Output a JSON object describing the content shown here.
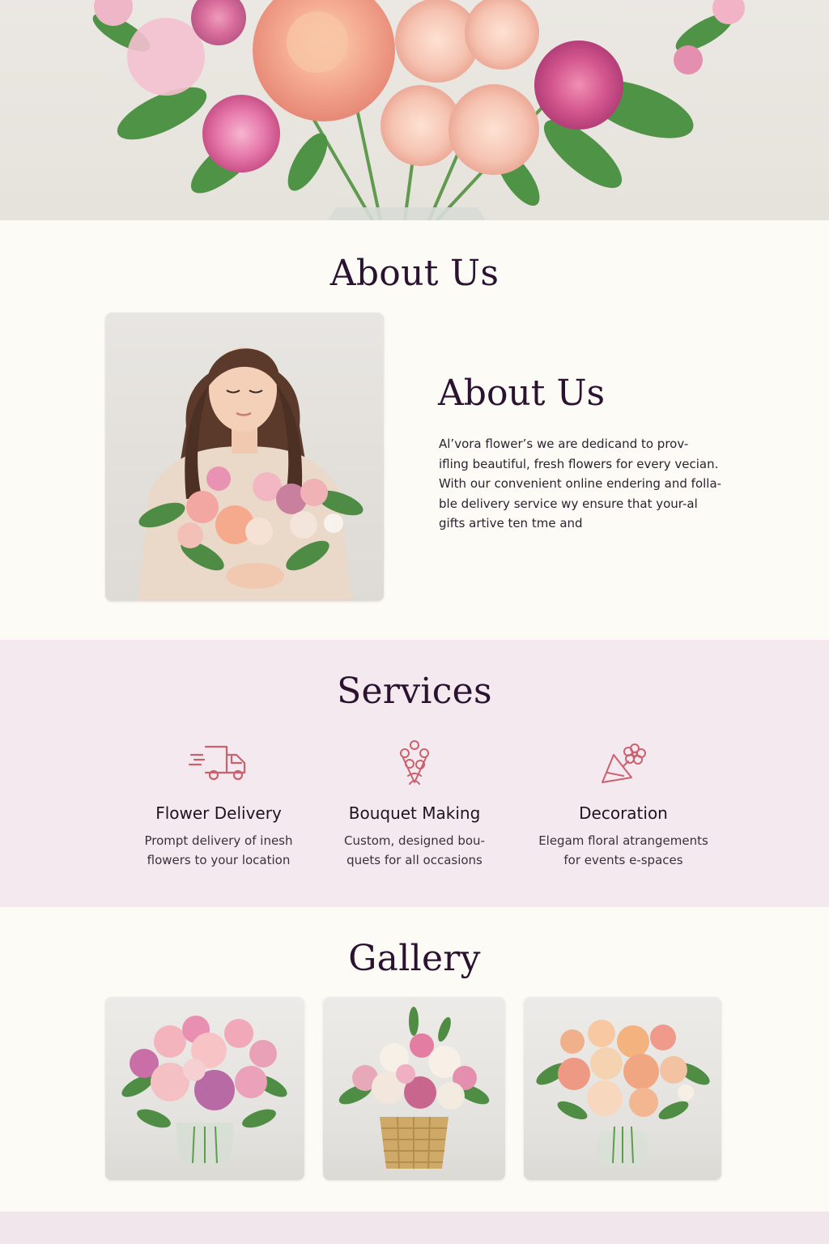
{
  "about": {
    "section_title": "About Us",
    "heading": "About Us",
    "paragraph_lines": [
      "Al’vora flower’s we are dedicand to prov-",
      "ifling beautiful, fresh flowers for every vecian.",
      "With our convenient online endering and folla-",
      "ble delivery service wy ensure that your-al",
      "gifts artive ten tme and"
    ]
  },
  "services": {
    "section_title": "Services",
    "items": [
      {
        "icon": "delivery-truck-icon",
        "title": "Flower Delivery",
        "desc_lines": [
          "Prompt delivery of inesh",
          "flowers to your location"
        ]
      },
      {
        "icon": "bouquet-icon",
        "title": "Bouquet Making",
        "desc_lines": [
          "Custom, designed bou-",
          "quets for all occasions"
        ]
      },
      {
        "icon": "decoration-icon",
        "title": "Decoration",
        "desc_lines": [
          "Elegam floral atrangements",
          "for events e-spaces"
        ]
      }
    ]
  },
  "gallery": {
    "section_title": "Gallery",
    "items": [
      {
        "name": "pink-bouquet-glass-vase"
      },
      {
        "name": "white-pink-bouquet-basket"
      },
      {
        "name": "peach-rose-bouquet-vase"
      }
    ]
  },
  "colors": {
    "background": "#fdfbf5",
    "services_background": "#f4e9ee",
    "heading": "#2a1230",
    "icon_accent": "#c9616f"
  }
}
